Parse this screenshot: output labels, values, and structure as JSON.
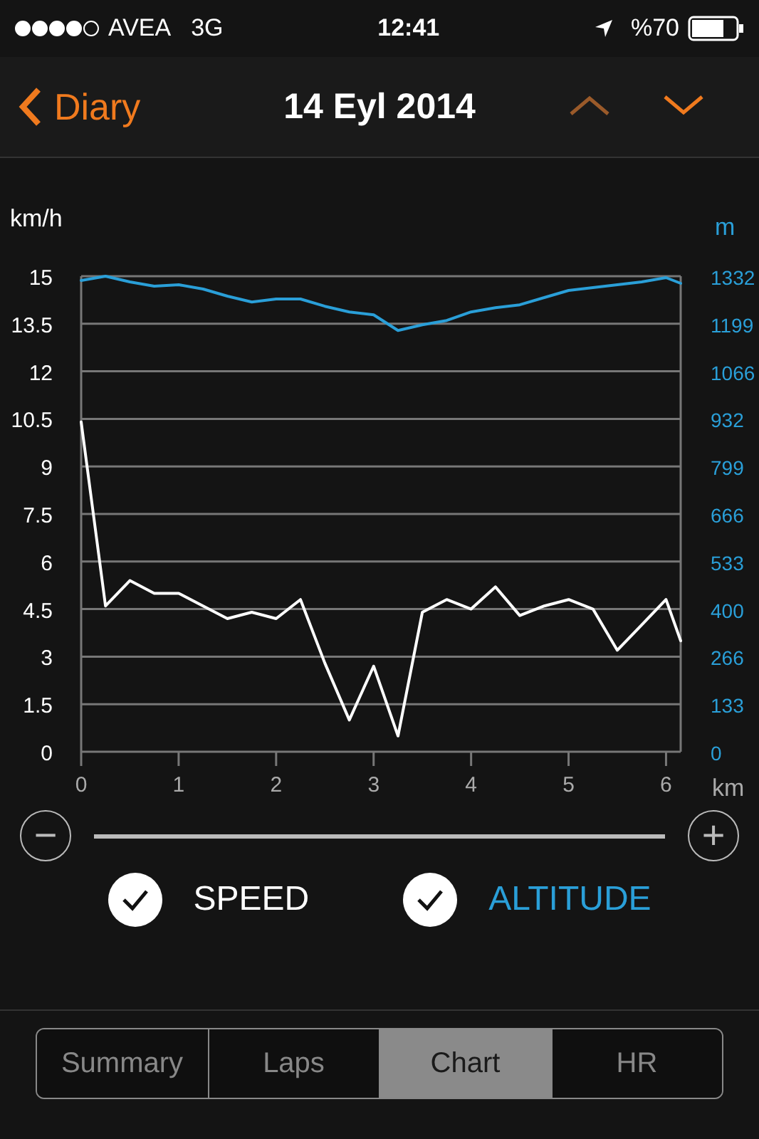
{
  "status_bar": {
    "carrier": "AVEA",
    "network": "3G",
    "time": "12:41",
    "battery": "%70"
  },
  "nav": {
    "back": "Diary",
    "title": "14 Eyl 2014",
    "prev_disabled": true,
    "next_disabled": false
  },
  "chart": {
    "chart_data": {
      "type": "line",
      "ylabel": "km/h",
      "xlabel": "km",
      "y2label": "m",
      "x": [
        0,
        0.25,
        0.5,
        0.75,
        1,
        1.25,
        1.5,
        1.75,
        2,
        2.25,
        2.5,
        2.75,
        3,
        3.25,
        3.5,
        3.75,
        4,
        4.25,
        4.5,
        4.75,
        5,
        5.25,
        5.5,
        5.75,
        6,
        6.15
      ],
      "xlim": [
        0,
        6.15
      ],
      "grid": true,
      "ylim": [
        0,
        15
      ],
      "y2lim": [
        0,
        1332
      ],
      "xticks": [
        0,
        1,
        2,
        3,
        4,
        5,
        6
      ],
      "yticks": [
        0,
        {
          "value": 1.5,
          "label": "1.5"
        },
        3,
        {
          "value": 4.5,
          "label": "4.5"
        },
        6,
        {
          "value": 7.5,
          "label": "7.5"
        },
        9,
        {
          "value": 10.5,
          "label": "10.5"
        },
        12,
        {
          "value": 13.5,
          "label": "13.5"
        },
        15
      ],
      "y2ticks": [
        0,
        {
          "value": 133.2,
          "label": "133"
        },
        {
          "value": 266.4,
          "label": "266"
        },
        {
          "value": 399.6,
          "label": "400"
        },
        {
          "value": 532.8,
          "label": "533"
        },
        666,
        {
          "value": 799.2,
          "label": "799"
        },
        {
          "value": 932.4,
          "label": "932"
        },
        {
          "value": 1065.6,
          "label": "1066"
        },
        {
          "value": 1198.8,
          "label": "1199"
        },
        1332
      ],
      "series": [
        {
          "name": "SPEED",
          "color": "#ffffff",
          "values": [
            10.4,
            4.6,
            5.4,
            5.0,
            5.0,
            4.6,
            4.2,
            4.4,
            4.2,
            4.8,
            2.8,
            1.0,
            2.7,
            0.5,
            4.4,
            4.8,
            4.5,
            5.2,
            4.3,
            4.6,
            4.8,
            4.5,
            3.2,
            4.0,
            4.8,
            3.5
          ]
        },
        {
          "name": "ALTITUDE",
          "color": "#2a9fd8",
          "axis": "y2",
          "values": [
            1320,
            1332,
            1316,
            1304,
            1308,
            1296,
            1276,
            1260,
            1268,
            1268,
            1248,
            1232,
            1224,
            1180,
            1196,
            1208,
            1232,
            1244,
            1252,
            1272,
            1292,
            1300,
            1308,
            1316,
            1328,
            1312
          ]
        }
      ]
    }
  },
  "zoom": {
    "minus": "−",
    "plus": "+"
  },
  "legend": [
    {
      "checked": true
    },
    {
      "checked": true
    }
  ],
  "tabs": [
    {
      "label": "Summary",
      "selected": false
    },
    {
      "label": "Laps",
      "selected": false
    },
    {
      "label": "Chart",
      "selected": true
    },
    {
      "label": "HR",
      "selected": false
    }
  ]
}
